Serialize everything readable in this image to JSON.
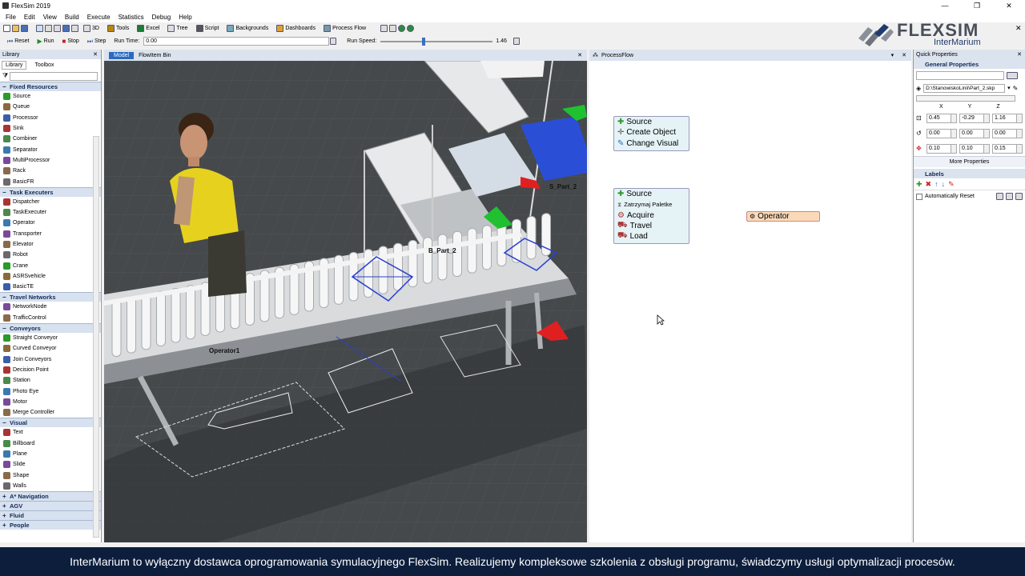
{
  "window": {
    "title": "FlexSim 2019",
    "min": "—",
    "max": "❐",
    "close": "✕"
  },
  "menu": [
    "File",
    "Edit",
    "View",
    "Build",
    "Execute",
    "Statistics",
    "Debug",
    "Help"
  ],
  "toolbar1": {
    "d3": "3D",
    "tools": "Tools",
    "excel": "Excel",
    "tree": "Tree",
    "script": "Script",
    "backgrounds": "Backgrounds",
    "dashboards": "Dashboards",
    "process_flow": "Process Flow"
  },
  "toolbar2": {
    "reset": "Reset",
    "run": "Run",
    "stop": "Stop",
    "step": "Step",
    "run_time_label": "Run Time:",
    "run_time": "0.00",
    "run_speed_label": "Run Speed:",
    "run_speed": "1.46"
  },
  "logo": {
    "brand": "FLEXSIM",
    "sub": "InterMarium"
  },
  "library": {
    "title": "Library",
    "tab_library": "Library",
    "tab_toolbox": "Toolbox",
    "categories": [
      {
        "name": "Fixed Resources",
        "items": [
          "Source",
          "Queue",
          "Processor",
          "Sink",
          "Combiner",
          "Separator",
          "MultiProcessor",
          "Rack",
          "BasicFR"
        ]
      },
      {
        "name": "Task Executers",
        "items": [
          "Dispatcher",
          "TaskExecuter",
          "Operator",
          "Transporter",
          "Elevator",
          "Robot",
          "Crane",
          "ASRSvehicle",
          "BasicTE"
        ]
      },
      {
        "name": "Travel Networks",
        "items": [
          "NetworkNode",
          "TrafficControl"
        ]
      },
      {
        "name": "Conveyors",
        "items": [
          "Straight Conveyor",
          "Curved Conveyor",
          "Join Conveyors",
          "Decision Point",
          "Station",
          "Photo Eye",
          "Motor",
          "Merge Controller"
        ]
      },
      {
        "name": "Visual",
        "items": [
          "Text",
          "Billboard",
          "Plane",
          "Slide",
          "Shape",
          "Walls"
        ]
      },
      {
        "name": "A* Navigation",
        "items": []
      },
      {
        "name": "AGV",
        "items": []
      },
      {
        "name": "Fluid",
        "items": []
      },
      {
        "name": "People",
        "items": []
      }
    ]
  },
  "model": {
    "tab_model": "Model",
    "tab_flowitem": "FlowItem Bin",
    "labels": {
      "operator": "Operator1",
      "s_part": "S_Part_2",
      "b_part": "B_Part_2"
    }
  },
  "process_flow": {
    "tab": "ProcessFlow",
    "block1": [
      "Source",
      "Create Object",
      "Change Visual"
    ],
    "block2": [
      "Source",
      "Zatrzymaj Paletke",
      "Acquire",
      "Travel",
      "Load"
    ],
    "resource": "Operator"
  },
  "quick_props": {
    "title": "Quick Properties",
    "general": "General Properties",
    "path": "D:\\StanowiskoLinii\\Part_2.skp",
    "axes": [
      "X",
      "Y",
      "Z"
    ],
    "position": [
      "0.45",
      "-0.29",
      "1.16"
    ],
    "rotation": [
      "0.00",
      "0.00",
      "0.00"
    ],
    "size": [
      "0.10",
      "0.10",
      "0.15"
    ],
    "more": "More Properties",
    "labels": "Labels",
    "auto_reset": "Automatically Reset"
  },
  "caption": "InterMarium to wyłączny dostawca oprogramowania symulacyjnego FlexSim. Realizujemy kompleksowe szkolenia z obsługi programu, świadczymy usługi optymalizacji procesów."
}
